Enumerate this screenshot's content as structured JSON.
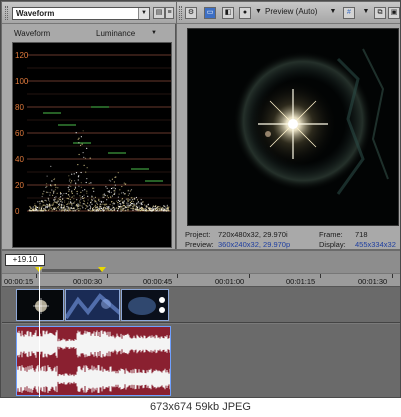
{
  "scope": {
    "selected_view": "Waveform",
    "mode_label": "Waveform",
    "channel_label": "Luminance",
    "ticks": [
      "120",
      "100",
      "80",
      "60",
      "40",
      "20",
      "0"
    ]
  },
  "preview": {
    "mode_label": "Preview (Auto)",
    "project_label": "Project:",
    "project_value": "720x480x32, 29.970i",
    "preview_label": "Preview:",
    "preview_value": "360x240x32, 29.970p",
    "frame_label": "Frame:",
    "frame_value": "718",
    "display_label": "Display:",
    "display_value": "455x334x32"
  },
  "timeline": {
    "timecode": "+19.10",
    "ruler_labels": [
      "00:00:15",
      "00:00:30",
      "00:00:45",
      "00:01:00",
      "00:01:15",
      "00:01:30"
    ]
  },
  "caption": "673x674  59kb  JPEG",
  "colors": {
    "audio_event": "#8a2030",
    "selection_border": "#6fa0ff",
    "playhead_marker": "#e8d800",
    "info_value": "#1f3fa0"
  }
}
